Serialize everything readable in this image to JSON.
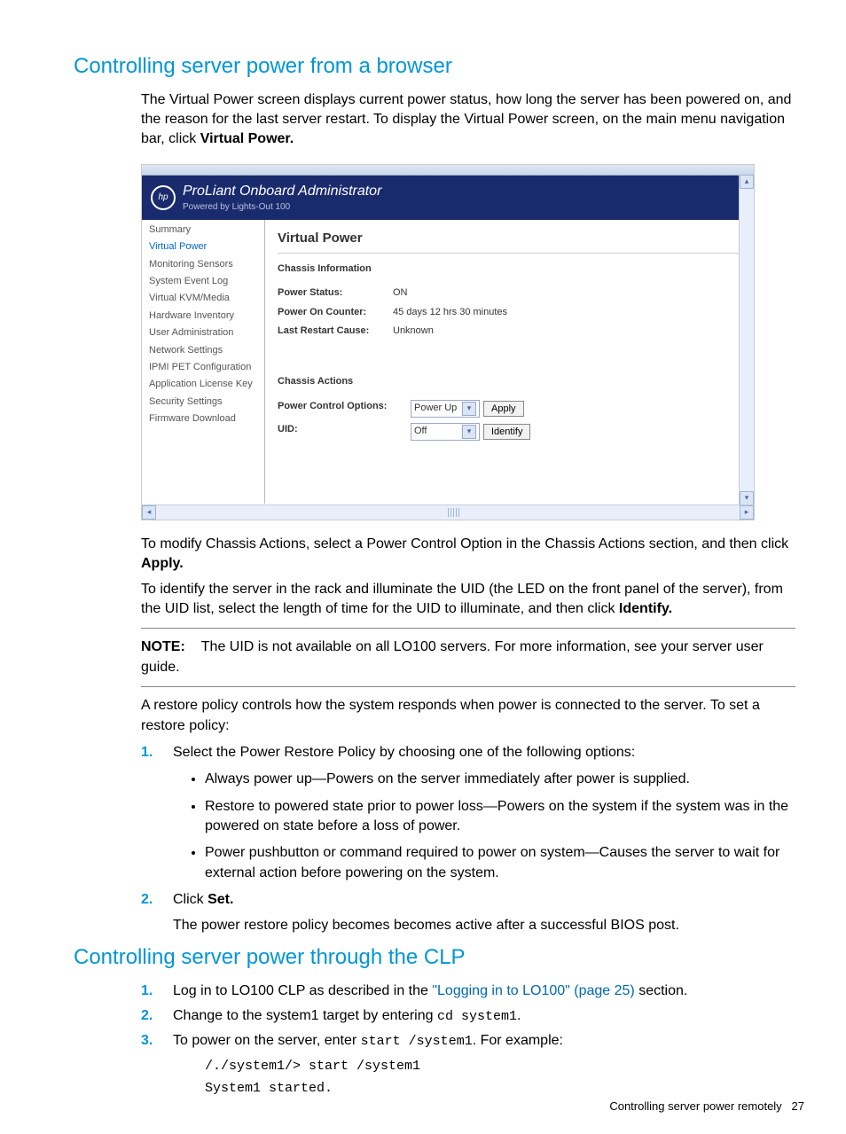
{
  "h1": "Controlling server power from a browser",
  "intro": {
    "p1a": "The Virtual Power screen displays current power status, how long the server has been powered on, and the reason for the last server restart. To display the Virtual Power screen, on the main menu navigation bar, click ",
    "p1b": "Virtual Power."
  },
  "screenshot": {
    "brand_line1": "ProLiant Onboard Administrator",
    "brand_line2": "Powered by Lights-Out 100",
    "nav": [
      "Summary",
      "Virtual Power",
      "Monitoring Sensors",
      "System Event Log",
      "Virtual KVM/Media",
      "Hardware Inventory",
      "User Administration",
      "Network Settings",
      "IPMI PET Configuration",
      "Application License Key",
      "Security Settings",
      "Firmware Download"
    ],
    "nav_selected_index": 1,
    "page_title": "Virtual Power",
    "section1": "Chassis Information",
    "rows1": [
      {
        "label": "Power Status:",
        "value": "ON"
      },
      {
        "label": "Power On Counter:",
        "value": "45 days 12 hrs 30 minutes"
      },
      {
        "label": "Last Restart Cause:",
        "value": "Unknown"
      }
    ],
    "section2": "Chassis Actions",
    "row_pco_label": "Power Control Options:",
    "row_pco_select": "Power Up",
    "row_pco_button": "Apply",
    "row_uid_label": "UID:",
    "row_uid_select": "Off",
    "row_uid_button": "Identify"
  },
  "after1": {
    "a": "To modify Chassis Actions, select a Power Control Option in the Chassis Actions section, and then click ",
    "b": "Apply."
  },
  "after2": {
    "a": "To identify the server in the rack and illuminate the UID (the LED on the front panel of the server), from the UID list, select the length of time for the UID to illuminate, and then click ",
    "b": "Identify."
  },
  "note": {
    "label": "NOTE:",
    "text": "The UID is not available on all LO100 servers. For more information, see your server user guide."
  },
  "restore_intro": "A restore policy controls how the system responds when power is connected to the server. To set a restore policy:",
  "step1_text": "Select the Power Restore Policy by choosing one of the following options:",
  "bullets": [
    "Always power up—Powers on the server immediately after power is supplied.",
    "Restore to powered state prior to power loss—Powers on the system if the system was in the powered on state before a loss of power.",
    "Power pushbutton or command required to power on system—Causes the server to wait for external action before powering on the system."
  ],
  "step2": {
    "a": "Click ",
    "b": "Set."
  },
  "step2_after": "The power restore policy becomes becomes active after a successful BIOS post.",
  "h2": "Controlling server power through the CLP",
  "clp": {
    "s1a": "Log in to LO100 CLP as described in the ",
    "s1link": "\"Logging in to LO100\" (page 25)",
    "s1b": " section.",
    "s2a": "Change to the system1 target by entering ",
    "s2code": "cd system1",
    "s2b": ".",
    "s3a": "To power on the server, enter ",
    "s3code": "start /system1",
    "s3b": ". For example:",
    "code1": "/./system1/> start /system1",
    "code2": "System1 started."
  },
  "footer": {
    "text": "Controlling server power remotely",
    "page": "27"
  }
}
